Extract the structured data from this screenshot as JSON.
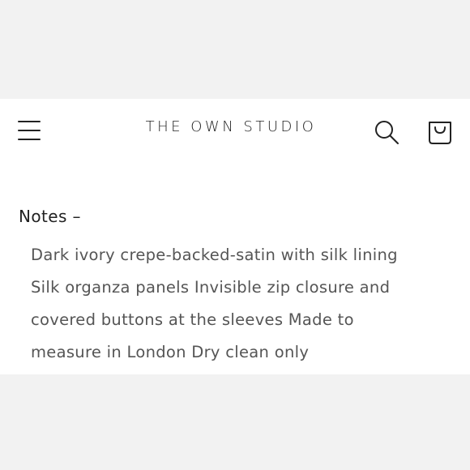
{
  "header": {
    "brand": "THE OWN STUDIO",
    "menu_icon": "hamburger-menu-icon",
    "search_icon": "search-icon",
    "cart_icon": "shopping-bag-icon"
  },
  "notes": {
    "heading": "Notes –",
    "lines": [
      "Dark ivory crepe-backed-satin with silk lining",
      "Silk organza panels Invisible zip closure and",
      "covered buttons at the sleeves Made to",
      "measure in London Dry clean only"
    ]
  },
  "colors": {
    "page_background": "#ffffff",
    "outer_background": "#f2f2f2",
    "text_dark": "#222222",
    "text_body": "#555555"
  }
}
